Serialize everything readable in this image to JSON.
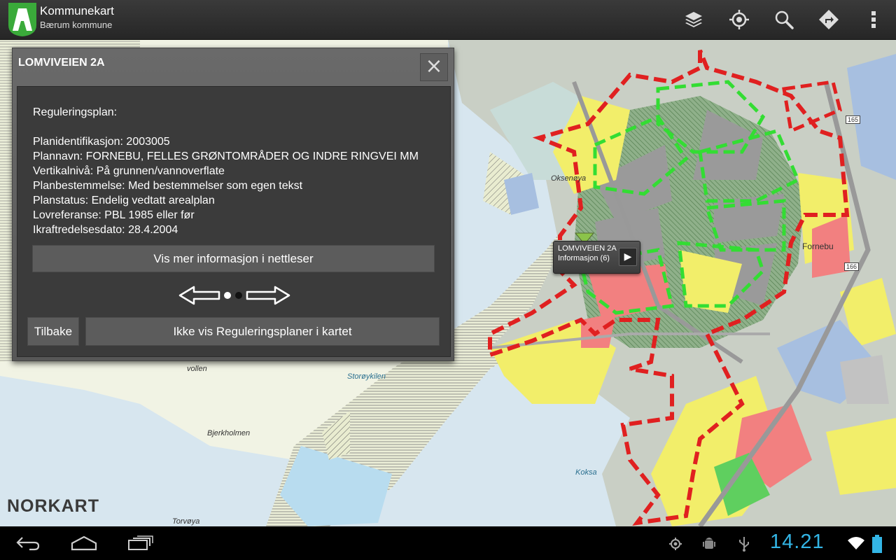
{
  "app": {
    "title": "Kommunekart",
    "subtitle": "Bærum kommune",
    "actions": [
      "layers-icon",
      "location-icon",
      "search-icon",
      "directions-icon",
      "overflow-menu-icon"
    ]
  },
  "map": {
    "places": [
      "Oksenøya",
      "Fornebu",
      "vollen",
      "Storøykilen",
      "Bjerkholmen",
      "Koksa",
      "Torvøya",
      "165",
      "166"
    ],
    "brand": "NORKART",
    "callout": {
      "line1": "LOMVIVEIEN 2A",
      "line2": "Informasjon (6)"
    },
    "colors": {
      "plan_boundary": "#e02020",
      "green_boundary": "#33dd33",
      "residential": "#f2ee6a",
      "commercial": "#f28080",
      "water": "#d7e6ef"
    }
  },
  "dialog": {
    "title": "LOMVIVEIEN 2A",
    "heading": "Reguleringsplan:",
    "lines": [
      "Planidentifikasjon: 2003005",
      "Plannavn: FORNEBU, FELLES GRØNTOMRÅDER OG INDRE RINGVEI MM",
      "Vertikalnivå: På grunnen/vannoverflate",
      "Planbestemmelse: Med bestemmelser som egen tekst",
      "Planstatus: Endelig vedtatt arealplan",
      "Lovreferanse: PBL 1985 eller før",
      "Ikraftredelsesdato: 28.4.2004"
    ],
    "more_button": "Vis mer informasjon i nettleser",
    "pager": {
      "total": 2,
      "current": 1
    },
    "back_button": "Tilbake",
    "hide_button": "Ikke vis Reguleringsplaner i kartet"
  },
  "system": {
    "clock": "14.21",
    "nav": [
      "back-icon",
      "home-icon",
      "recents-icon"
    ]
  }
}
